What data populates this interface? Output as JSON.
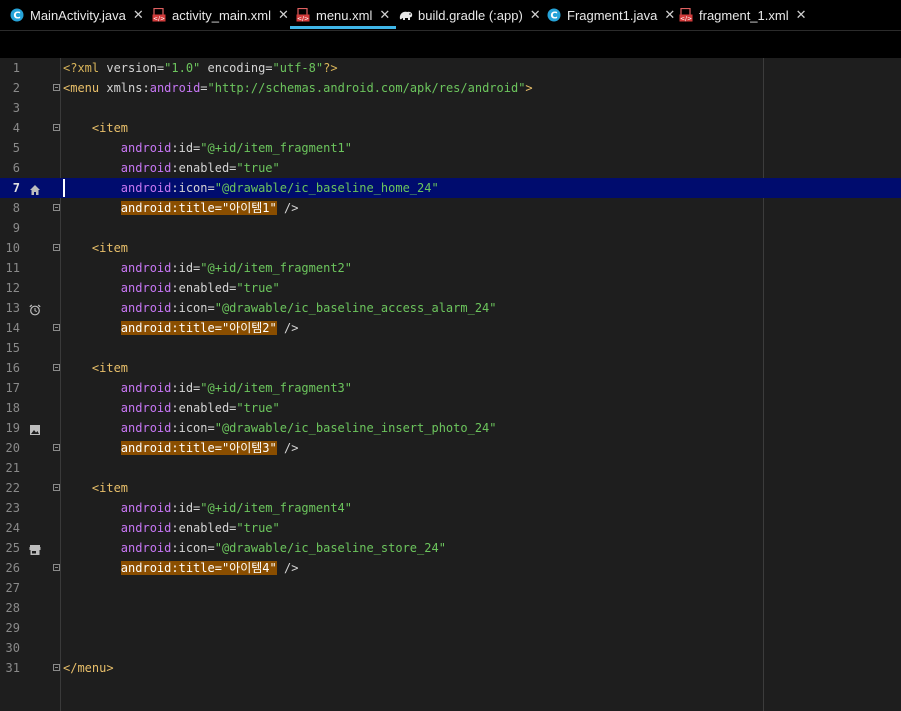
{
  "tabs": [
    {
      "label": "MainActivity.java",
      "icon": "java-class-icon"
    },
    {
      "label": "activity_main.xml",
      "icon": "xml-layout-icon"
    },
    {
      "label": "menu.xml",
      "icon": "xml-layout-icon",
      "active": true
    },
    {
      "label": "build.gradle (:app)",
      "icon": "gradle-elephant-icon"
    },
    {
      "label": "Fragment1.java",
      "icon": "java-class-icon"
    },
    {
      "label": "fragment_1.xml",
      "icon": "xml-layout-icon"
    }
  ],
  "tab_close_glyph": "✕",
  "colors": {
    "accent": "#3fb6e8",
    "current_line": "#000c6e",
    "highlight": "#8a4e00",
    "string": "#6cc55d",
    "namespace": "#c777f5",
    "tag": "#e8bf6a"
  },
  "editor": {
    "current_line": 7,
    "lines": [
      {
        "n": "1",
        "segs": [
          [
            "pi",
            "<?xml "
          ],
          [
            "at",
            "version="
          ],
          [
            "val",
            "\"1.0\""
          ],
          [
            "at",
            " encoding="
          ],
          [
            "val",
            "\"utf-8\""
          ],
          [
            "pi",
            "?>"
          ]
        ]
      },
      {
        "n": "2",
        "fold": true,
        "segs": [
          [
            "tag",
            "<menu "
          ],
          [
            "at",
            "xmlns:"
          ],
          [
            "ns",
            "android"
          ],
          [
            "at",
            "="
          ],
          [
            "val",
            "\"http://schemas.android.com/apk/res/android\""
          ],
          [
            "tag",
            ">"
          ]
        ]
      },
      {
        "n": "3",
        "segs": []
      },
      {
        "n": "4",
        "fold": true,
        "segs": [
          [
            "at",
            "    "
          ],
          [
            "tag",
            "<item"
          ]
        ]
      },
      {
        "n": "5",
        "segs": [
          [
            "at",
            "        "
          ],
          [
            "ns",
            "android"
          ],
          [
            "at",
            ":id="
          ],
          [
            "val",
            "\"@+id/item_fragment1\""
          ]
        ]
      },
      {
        "n": "6",
        "segs": [
          [
            "at",
            "        "
          ],
          [
            "ns",
            "android"
          ],
          [
            "at",
            ":enabled="
          ],
          [
            "val",
            "\"true\""
          ]
        ]
      },
      {
        "n": "7",
        "gicon": "home-icon",
        "segs": [
          [
            "at",
            "        "
          ],
          [
            "ns",
            "android"
          ],
          [
            "at",
            ":icon="
          ],
          [
            "val",
            "\"@drawable/ic_baseline_home_24\""
          ]
        ]
      },
      {
        "n": "8",
        "fold": true,
        "segs": [
          [
            "at",
            "        "
          ],
          [
            "hl",
            "android:title=\"아이템1\""
          ],
          [
            "at",
            " />"
          ]
        ]
      },
      {
        "n": "9",
        "segs": []
      },
      {
        "n": "10",
        "fold": true,
        "segs": [
          [
            "at",
            "    "
          ],
          [
            "tag",
            "<item"
          ]
        ]
      },
      {
        "n": "11",
        "segs": [
          [
            "at",
            "        "
          ],
          [
            "ns",
            "android"
          ],
          [
            "at",
            ":id="
          ],
          [
            "val",
            "\"@+id/item_fragment2\""
          ]
        ]
      },
      {
        "n": "12",
        "segs": [
          [
            "at",
            "        "
          ],
          [
            "ns",
            "android"
          ],
          [
            "at",
            ":enabled="
          ],
          [
            "val",
            "\"true\""
          ]
        ]
      },
      {
        "n": "13",
        "gicon": "alarm-icon",
        "segs": [
          [
            "at",
            "        "
          ],
          [
            "ns",
            "android"
          ],
          [
            "at",
            ":icon="
          ],
          [
            "val",
            "\"@drawable/ic_baseline_access_alarm_24\""
          ]
        ]
      },
      {
        "n": "14",
        "fold": true,
        "segs": [
          [
            "at",
            "        "
          ],
          [
            "hl",
            "android:title=\"아이템2\""
          ],
          [
            "at",
            " />"
          ]
        ]
      },
      {
        "n": "15",
        "segs": []
      },
      {
        "n": "16",
        "fold": true,
        "segs": [
          [
            "at",
            "    "
          ],
          [
            "tag",
            "<item"
          ]
        ]
      },
      {
        "n": "17",
        "segs": [
          [
            "at",
            "        "
          ],
          [
            "ns",
            "android"
          ],
          [
            "at",
            ":id="
          ],
          [
            "val",
            "\"@+id/item_fragment3\""
          ]
        ]
      },
      {
        "n": "18",
        "segs": [
          [
            "at",
            "        "
          ],
          [
            "ns",
            "android"
          ],
          [
            "at",
            ":enabled="
          ],
          [
            "val",
            "\"true\""
          ]
        ]
      },
      {
        "n": "19",
        "gicon": "photo-icon",
        "segs": [
          [
            "at",
            "        "
          ],
          [
            "ns",
            "android"
          ],
          [
            "at",
            ":icon="
          ],
          [
            "val",
            "\"@drawable/ic_baseline_insert_photo_24\""
          ]
        ]
      },
      {
        "n": "20",
        "fold": true,
        "segs": [
          [
            "at",
            "        "
          ],
          [
            "hl",
            "android:title=\"아이템3\""
          ],
          [
            "at",
            " />"
          ]
        ]
      },
      {
        "n": "21",
        "segs": []
      },
      {
        "n": "22",
        "fold": true,
        "segs": [
          [
            "at",
            "    "
          ],
          [
            "tag",
            "<item"
          ]
        ]
      },
      {
        "n": "23",
        "segs": [
          [
            "at",
            "        "
          ],
          [
            "ns",
            "android"
          ],
          [
            "at",
            ":id="
          ],
          [
            "val",
            "\"@+id/item_fragment4\""
          ]
        ]
      },
      {
        "n": "24",
        "segs": [
          [
            "at",
            "        "
          ],
          [
            "ns",
            "android"
          ],
          [
            "at",
            ":enabled="
          ],
          [
            "val",
            "\"true\""
          ]
        ]
      },
      {
        "n": "25",
        "gicon": "store-icon",
        "segs": [
          [
            "at",
            "        "
          ],
          [
            "ns",
            "android"
          ],
          [
            "at",
            ":icon="
          ],
          [
            "val",
            "\"@drawable/ic_baseline_store_24\""
          ]
        ]
      },
      {
        "n": "26",
        "fold": true,
        "segs": [
          [
            "at",
            "        "
          ],
          [
            "hl",
            "android:title=\"아이템4\""
          ],
          [
            "at",
            " />"
          ]
        ]
      },
      {
        "n": "27",
        "segs": []
      },
      {
        "n": "28",
        "segs": []
      },
      {
        "n": "29",
        "segs": []
      },
      {
        "n": "30",
        "segs": []
      },
      {
        "n": "31",
        "fold": true,
        "segs": [
          [
            "tag",
            "</menu>"
          ]
        ]
      }
    ]
  }
}
